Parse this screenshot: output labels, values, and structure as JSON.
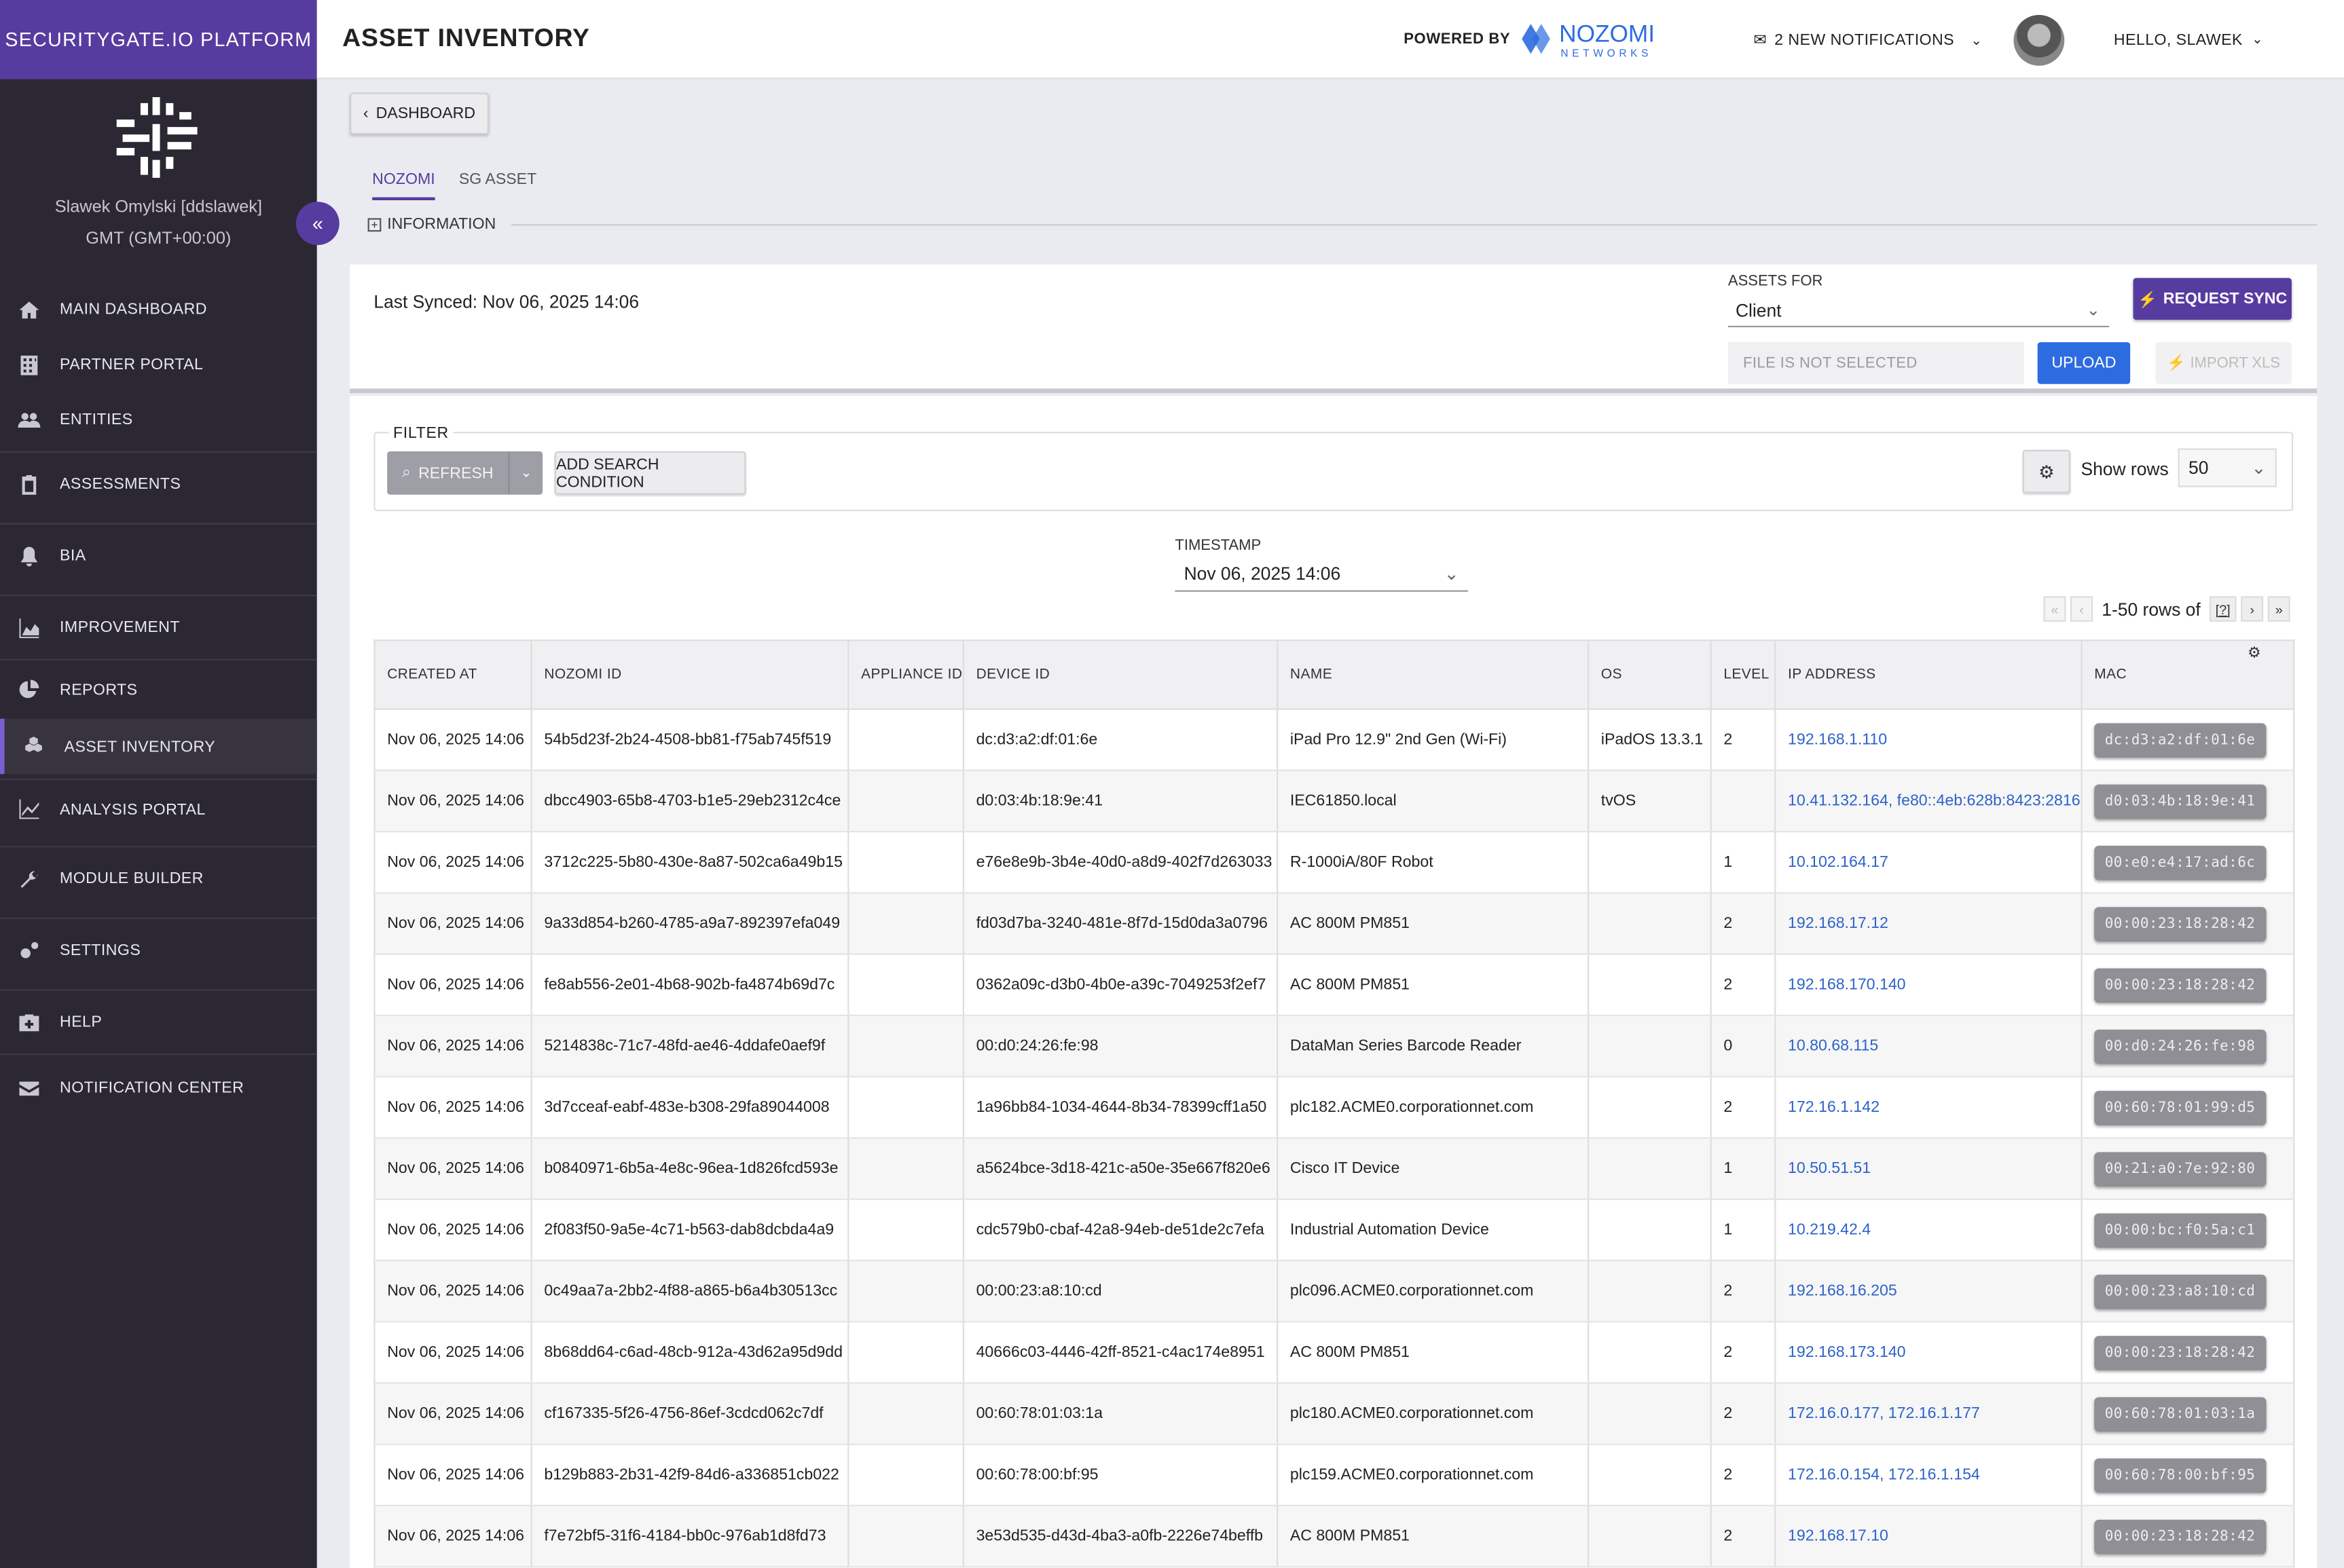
{
  "sidebar": {
    "brand": "SECURITYGATE.IO PLATFORM",
    "user_name": "Slawek Omylski [ddslawek]",
    "timezone": "GMT (GMT+00:00)",
    "collapse_label": "«",
    "items": [
      {
        "label": "MAIN DASHBOARD",
        "icon": "home-icon"
      },
      {
        "label": "PARTNER PORTAL",
        "icon": "building-icon"
      },
      {
        "label": "ENTITIES",
        "icon": "users-icon"
      },
      {
        "label": "ASSESSMENTS",
        "icon": "clipboard-icon"
      },
      {
        "label": "BIA",
        "icon": "bell-icon"
      },
      {
        "label": "IMPROVEMENT",
        "icon": "area-chart-icon"
      },
      {
        "label": "REPORTS",
        "icon": "pie-chart-icon"
      },
      {
        "label": "ASSET INVENTORY",
        "icon": "cubes-icon"
      },
      {
        "label": "ANALYSIS PORTAL",
        "icon": "line-chart-icon"
      },
      {
        "label": "MODULE BUILDER",
        "icon": "wrench-icon"
      },
      {
        "label": "SETTINGS",
        "icon": "gears-icon"
      },
      {
        "label": "HELP",
        "icon": "medkit-icon"
      },
      {
        "label": "NOTIFICATION CENTER",
        "icon": "envelope-icon"
      }
    ]
  },
  "topbar": {
    "title": "ASSET INVENTORY",
    "powered_by": "POWERED BY",
    "nozomi_logo_text": "NOZOMI",
    "nozomi_logo_sub": "NETWORKS",
    "notifications": "2 NEW NOTIFICATIONS",
    "greeting": "HELLO, SLAWEK"
  },
  "nav": {
    "dashboard_button": "DASHBOARD",
    "tabs": [
      "NOZOMI",
      "SG ASSET"
    ],
    "active_tab": "NOZOMI",
    "information_toggle": "INFORMATION"
  },
  "sync": {
    "last_synced": "Last Synced: Nov 06, 2025 14:06",
    "assets_for_label": "ASSETS FOR",
    "assets_for_value": "Client",
    "request_sync": "REQUEST SYNC",
    "file_placeholder": "FILE IS NOT SELECTED",
    "upload": "UPLOAD",
    "import_xls": "IMPORT XLS"
  },
  "filter": {
    "label": "FILTER",
    "refresh": "REFRESH",
    "add_condition": "ADD SEARCH CONDITION",
    "show_rows_label": "Show rows",
    "show_rows_value": "50"
  },
  "timestamp": {
    "label": "TIMESTAMP",
    "value": "Nov 06, 2025 14:06"
  },
  "pager": {
    "range": "1-50 rows of",
    "total": "[?]"
  },
  "table": {
    "columns": [
      "CREATED AT",
      "NOZOMI ID",
      "APPLIANCE ID",
      "DEVICE ID",
      "NAME",
      "OS",
      "LEVEL",
      "IP ADDRESS",
      "MAC"
    ],
    "rows": [
      {
        "created": "Nov 06, 2025 14:06",
        "nozomi_id": "54b5d23f-2b24-4508-bb81-f75ab745f519",
        "appliance_id": "",
        "device_id": "dc:d3:a2:df:01:6e",
        "name": "iPad Pro 12.9\" 2nd Gen (Wi-Fi)",
        "os": "iPadOS 13.3.1",
        "level": "2",
        "ip": "192.168.1.110",
        "mac": "dc:d3:a2:df:01:6e"
      },
      {
        "created": "Nov 06, 2025 14:06",
        "nozomi_id": "dbcc4903-65b8-4703-b1e5-29eb2312c4ce",
        "appliance_id": "",
        "device_id": "d0:03:4b:18:9e:41",
        "name": "IEC61850.local",
        "os": "tvOS",
        "level": "",
        "ip": "10.41.132.164, fe80::4eb:628b:8423:2816",
        "mac": "d0:03:4b:18:9e:41"
      },
      {
        "created": "Nov 06, 2025 14:06",
        "nozomi_id": "3712c225-5b80-430e-8a87-502ca6a49b15",
        "appliance_id": "",
        "device_id": "e76e8e9b-3b4e-40d0-a8d9-402f7d263033",
        "name": "R-1000iA/80F Robot",
        "os": "",
        "level": "1",
        "ip": "10.102.164.17",
        "mac": "00:e0:e4:17:ad:6c"
      },
      {
        "created": "Nov 06, 2025 14:06",
        "nozomi_id": "9a33d854-b260-4785-a9a7-892397efa049",
        "appliance_id": "",
        "device_id": "fd03d7ba-3240-481e-8f7d-15d0da3a0796",
        "name": "AC 800M PM851",
        "os": "",
        "level": "2",
        "ip": "192.168.17.12",
        "mac": "00:00:23:18:28:42"
      },
      {
        "created": "Nov 06, 2025 14:06",
        "nozomi_id": "fe8ab556-2e01-4b68-902b-fa4874b69d7c",
        "appliance_id": "",
        "device_id": "0362a09c-d3b0-4b0e-a39c-7049253f2ef7",
        "name": "AC 800M PM851",
        "os": "",
        "level": "2",
        "ip": "192.168.170.140",
        "mac": "00:00:23:18:28:42"
      },
      {
        "created": "Nov 06, 2025 14:06",
        "nozomi_id": "5214838c-71c7-48fd-ae46-4ddafe0aef9f",
        "appliance_id": "",
        "device_id": "00:d0:24:26:fe:98",
        "name": "DataMan Series Barcode Reader",
        "os": "",
        "level": "0",
        "ip": "10.80.68.115",
        "mac": "00:d0:24:26:fe:98"
      },
      {
        "created": "Nov 06, 2025 14:06",
        "nozomi_id": "3d7cceaf-eabf-483e-b308-29fa89044008",
        "appliance_id": "",
        "device_id": "1a96bb84-1034-4644-8b34-78399cff1a50",
        "name": "plc182.ACME0.corporationnet.com",
        "os": "",
        "level": "2",
        "ip": "172.16.1.142",
        "mac": "00:60:78:01:99:d5"
      },
      {
        "created": "Nov 06, 2025 14:06",
        "nozomi_id": "b0840971-6b5a-4e8c-96ea-1d826fcd593e",
        "appliance_id": "",
        "device_id": "a5624bce-3d18-421c-a50e-35e667f820e6",
        "name": "Cisco IT Device",
        "os": "",
        "level": "1",
        "ip": "10.50.51.51",
        "mac": "00:21:a0:7e:92:80"
      },
      {
        "created": "Nov 06, 2025 14:06",
        "nozomi_id": "2f083f50-9a5e-4c71-b563-dab8dcbda4a9",
        "appliance_id": "",
        "device_id": "cdc579b0-cbaf-42a8-94eb-de51de2c7efa",
        "name": "Industrial Automation Device",
        "os": "",
        "level": "1",
        "ip": "10.219.42.4",
        "mac": "00:00:bc:f0:5a:c1"
      },
      {
        "created": "Nov 06, 2025 14:06",
        "nozomi_id": "0c49aa7a-2bb2-4f88-a865-b6a4b30513cc",
        "appliance_id": "",
        "device_id": "00:00:23:a8:10:cd",
        "name": "plc096.ACME0.corporationnet.com",
        "os": "",
        "level": "2",
        "ip": "192.168.16.205",
        "mac": "00:00:23:a8:10:cd"
      },
      {
        "created": "Nov 06, 2025 14:06",
        "nozomi_id": "8b68dd64-c6ad-48cb-912a-43d62a95d9dd",
        "appliance_id": "",
        "device_id": "40666c03-4446-42ff-8521-c4ac174e8951",
        "name": "AC 800M PM851",
        "os": "",
        "level": "2",
        "ip": "192.168.173.140",
        "mac": "00:00:23:18:28:42"
      },
      {
        "created": "Nov 06, 2025 14:06",
        "nozomi_id": "cf167335-5f26-4756-86ef-3cdcd062c7df",
        "appliance_id": "",
        "device_id": "00:60:78:01:03:1a",
        "name": "plc180.ACME0.corporationnet.com",
        "os": "",
        "level": "2",
        "ip": "172.16.0.177, 172.16.1.177",
        "mac": "00:60:78:01:03:1a"
      },
      {
        "created": "Nov 06, 2025 14:06",
        "nozomi_id": "b129b883-2b31-42f9-84d6-a336851cb022",
        "appliance_id": "",
        "device_id": "00:60:78:00:bf:95",
        "name": "plc159.ACME0.corporationnet.com",
        "os": "",
        "level": "2",
        "ip": "172.16.0.154, 172.16.1.154",
        "mac": "00:60:78:00:bf:95"
      },
      {
        "created": "Nov 06, 2025 14:06",
        "nozomi_id": "f7e72bf5-31f6-4184-bb0c-976ab1d8fd73",
        "appliance_id": "",
        "device_id": "3e53d535-d43d-4ba3-a0fb-2226e74beffb",
        "name": "AC 800M PM851",
        "os": "",
        "level": "2",
        "ip": "192.168.17.10",
        "mac": "00:00:23:18:28:42"
      }
    ]
  },
  "colors": {
    "brand_purple": "#573ca0",
    "sidebar_bg": "#2b2834",
    "upload_blue": "#2d6ce0",
    "link_blue": "#2d63c8"
  }
}
